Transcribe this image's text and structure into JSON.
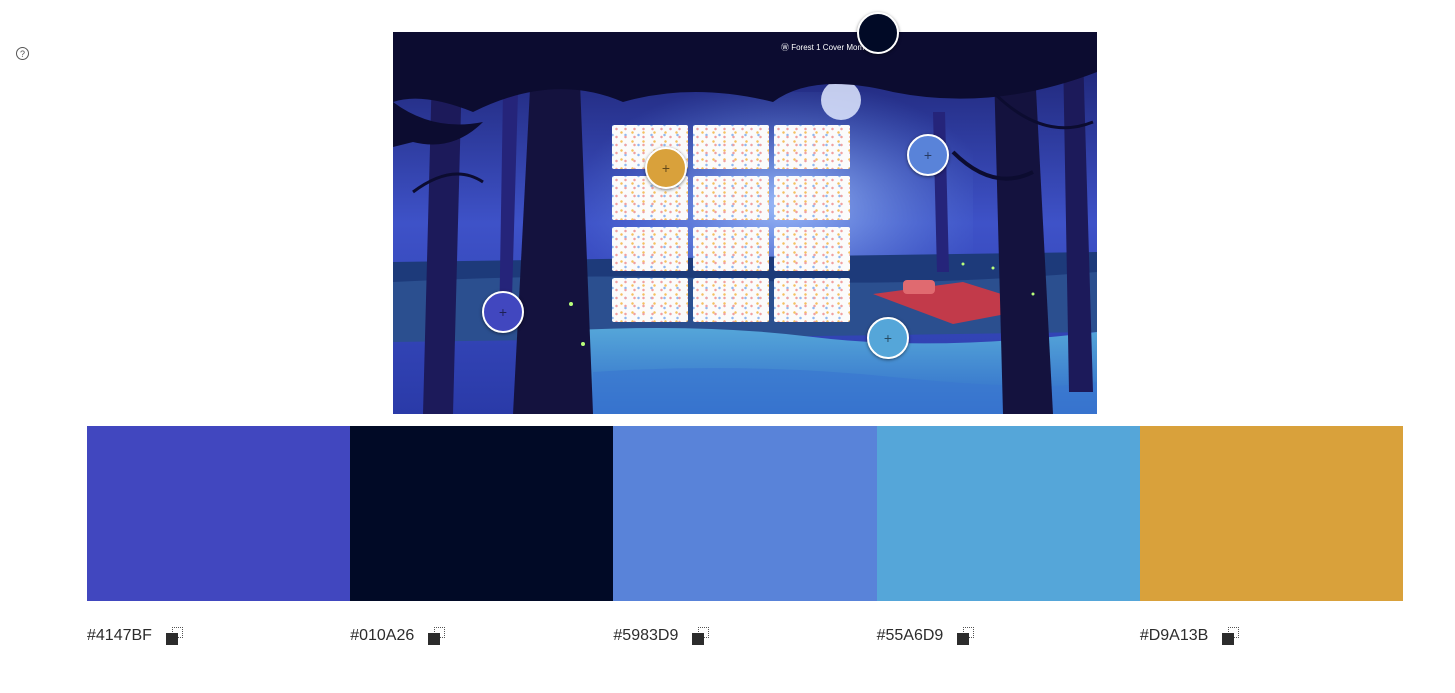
{
  "help": {
    "icon": "help-icon",
    "glyph": "?"
  },
  "image": {
    "tile_title": "Ⓦ Forest 1 Cover Moment",
    "tile_count": 12
  },
  "pickers": [
    {
      "name": "picker-navy",
      "color": "#010A26",
      "glyph": ""
    },
    {
      "name": "picker-gold",
      "color": "#D9A13B",
      "glyph": "+"
    },
    {
      "name": "picker-cornflower",
      "color": "#5983D9",
      "glyph": "+"
    },
    {
      "name": "picker-indigo",
      "color": "#4147BF",
      "glyph": "+"
    },
    {
      "name": "picker-sky",
      "color": "#55A6D9",
      "glyph": "+"
    }
  ],
  "palette": [
    {
      "hex": "#4147BF",
      "color": "#4147BF"
    },
    {
      "hex": "#010A26",
      "color": "#010A26"
    },
    {
      "hex": "#5983D9",
      "color": "#5983D9"
    },
    {
      "hex": "#55A6D9",
      "color": "#55A6D9"
    },
    {
      "hex": "#D9A13B",
      "color": "#D9A13B"
    }
  ]
}
